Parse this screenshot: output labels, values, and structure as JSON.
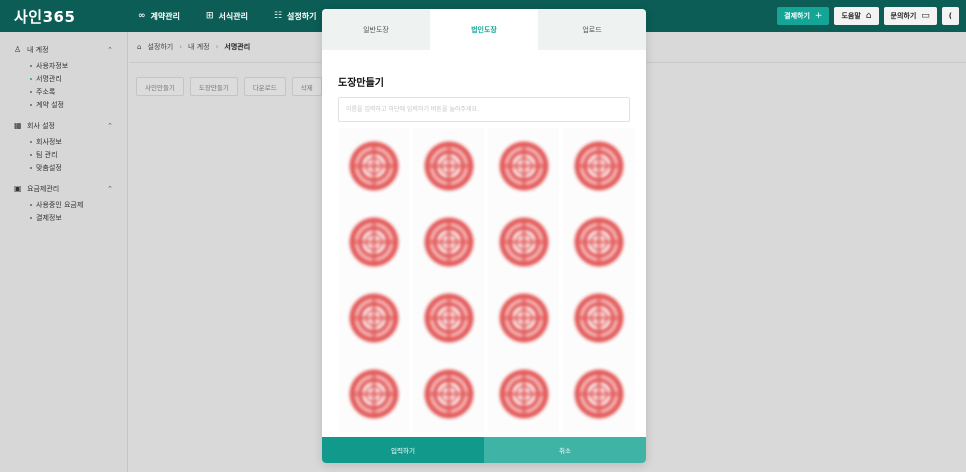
{
  "app": {
    "logo": "사인365"
  },
  "topnav": {
    "items": [
      {
        "label": "계약관리",
        "icon": "∞"
      },
      {
        "label": "서식관리",
        "icon": "⊞"
      },
      {
        "label": "설정하기",
        "icon": "☷"
      }
    ]
  },
  "topbar_right": {
    "user_info": "",
    "buttons": [
      {
        "label": "결제하기",
        "icon": "+"
      },
      {
        "label": "도움말",
        "icon": "⌂"
      },
      {
        "label": "문의하기",
        "icon": "▭"
      },
      {
        "label": "(",
        "icon": ""
      }
    ]
  },
  "sidebar": {
    "groups": [
      {
        "title": "내 계정",
        "icon": "user-icon",
        "items": [
          "사용자정보",
          "서명관리",
          "주소록",
          "계약 설정"
        ]
      },
      {
        "title": "회사 설정",
        "icon": "building-icon",
        "items": [
          "회사정보",
          "팀 관리",
          "맞춤설정"
        ]
      },
      {
        "title": "요금제관리",
        "icon": "receipt-icon",
        "items": [
          "사용중인 요금제",
          "결제정보"
        ]
      }
    ]
  },
  "breadcrumb": {
    "items": [
      "설정하기",
      "내 계정",
      "서명관리"
    ]
  },
  "actions": [
    "사인만들기",
    "도장만들기",
    "다운로드",
    "삭제"
  ],
  "modal": {
    "tabs": [
      "일반도장",
      "법인도장",
      "업로드"
    ],
    "active_tab": 1,
    "title": "도장만들기",
    "input_placeholder": "이름을 입력하고 하단에 입력하기 버튼을 눌러주세요.",
    "seal_count": 16,
    "ok_label": "입력하기",
    "cancel_label": "취소"
  },
  "colors": {
    "topbar": "#0b5d55",
    "accent": "#14a597",
    "seal": "#e25a5a"
  }
}
